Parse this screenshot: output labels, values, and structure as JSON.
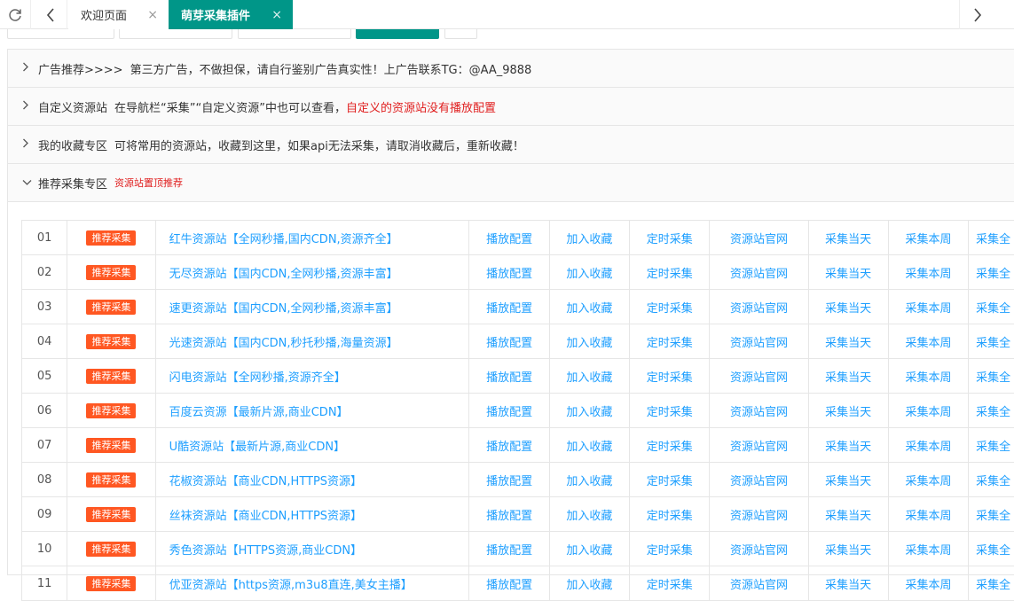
{
  "tabs": {
    "welcome": "欢迎页面",
    "active": "萌芽采集插件",
    "close_glyph": "×"
  },
  "panels": {
    "ads": {
      "title": "广告推荐>>>>",
      "text": "第三方广告，不做担保，请自行鉴别广告真实性！上广告联系TG：@AA_9888"
    },
    "custom": {
      "title": "自定义资源站",
      "text": "在导航栏“采集”“自定义资源”中也可以查看，",
      "warning": "自定义的资源站没有播放配置"
    },
    "favorites": {
      "title": "我的收藏专区",
      "text": "可将常用的资源站，收藏到这里，如果api无法采集，请取消收藏后，重新收藏！"
    },
    "recommended": {
      "title": "推荐采集专区",
      "tag": "资源站置顶推荐"
    }
  },
  "actions": [
    "播放配置",
    "加入收藏",
    "定时采集",
    "资源站官网",
    "采集当天",
    "采集本周",
    "采集全"
  ],
  "badge_label": "推荐采集",
  "rows": [
    {
      "num": "01",
      "name": "红牛资源站【全网秒播,国内CDN,资源齐全】"
    },
    {
      "num": "02",
      "name": "无尽资源站【国内CDN,全网秒播,资源丰富】"
    },
    {
      "num": "03",
      "name": "速更资源站【国内CDN,全网秒播,资源丰富】"
    },
    {
      "num": "04",
      "name": "光速资源站【国内CDN,秒托秒播,海量资源】"
    },
    {
      "num": "05",
      "name": "闪电资源站【全网秒播,资源齐全】"
    },
    {
      "num": "06",
      "name": "百度云资源【最新片源,商业CDN】"
    },
    {
      "num": "07",
      "name": "U酷资源站【最新片源,商业CDN】"
    },
    {
      "num": "08",
      "name": "花椒资源站【商业CDN,HTTPS资源】"
    },
    {
      "num": "09",
      "name": "丝袜资源站【商业CDN,HTTPS资源】"
    },
    {
      "num": "10",
      "name": "秀色资源站【HTTPS资源,商业CDN】"
    },
    {
      "num": "11",
      "name": "优亚资源站【https资源,m3u8直连,美女主播】"
    }
  ],
  "colors": {
    "accent": "#009688",
    "link": "#1e9fff",
    "badge": "#ff5722",
    "warning": "#e01e1e"
  }
}
